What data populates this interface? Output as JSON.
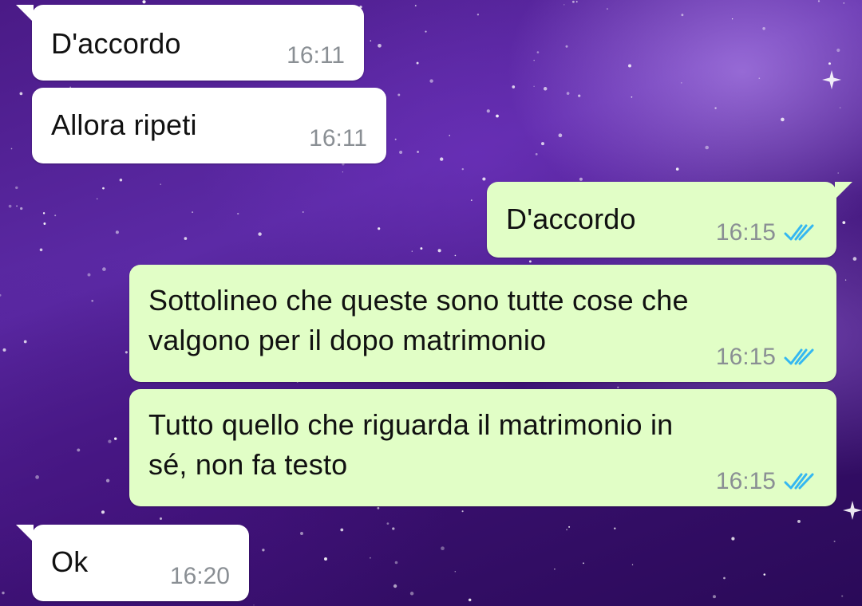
{
  "colors": {
    "incoming_bubble": "#ffffff",
    "outgoing_bubble": "#e1fec6",
    "timestamp": "#8a8f94",
    "read_receipt": "#34b7f1"
  },
  "messages": [
    {
      "direction": "incoming",
      "text": "D'accordo",
      "time": "16:11"
    },
    {
      "direction": "incoming",
      "text": "Allora ripeti",
      "time": "16:11"
    },
    {
      "direction": "outgoing",
      "text": "D'accordo",
      "time": "16:15",
      "status_icon": "double-check-icon"
    },
    {
      "direction": "outgoing",
      "lines": [
        "Sottolineo che queste sono tutte cose che",
        "valgono per il dopo matrimonio"
      ],
      "time": "16:15",
      "status_icon": "double-check-icon"
    },
    {
      "direction": "outgoing",
      "lines": [
        "Tutto quello che riguarda il matrimonio in",
        "sé, non fa testo"
      ],
      "time": "16:15",
      "status_icon": "double-check-icon"
    },
    {
      "direction": "incoming",
      "text": "Ok",
      "time": "16:20"
    }
  ]
}
